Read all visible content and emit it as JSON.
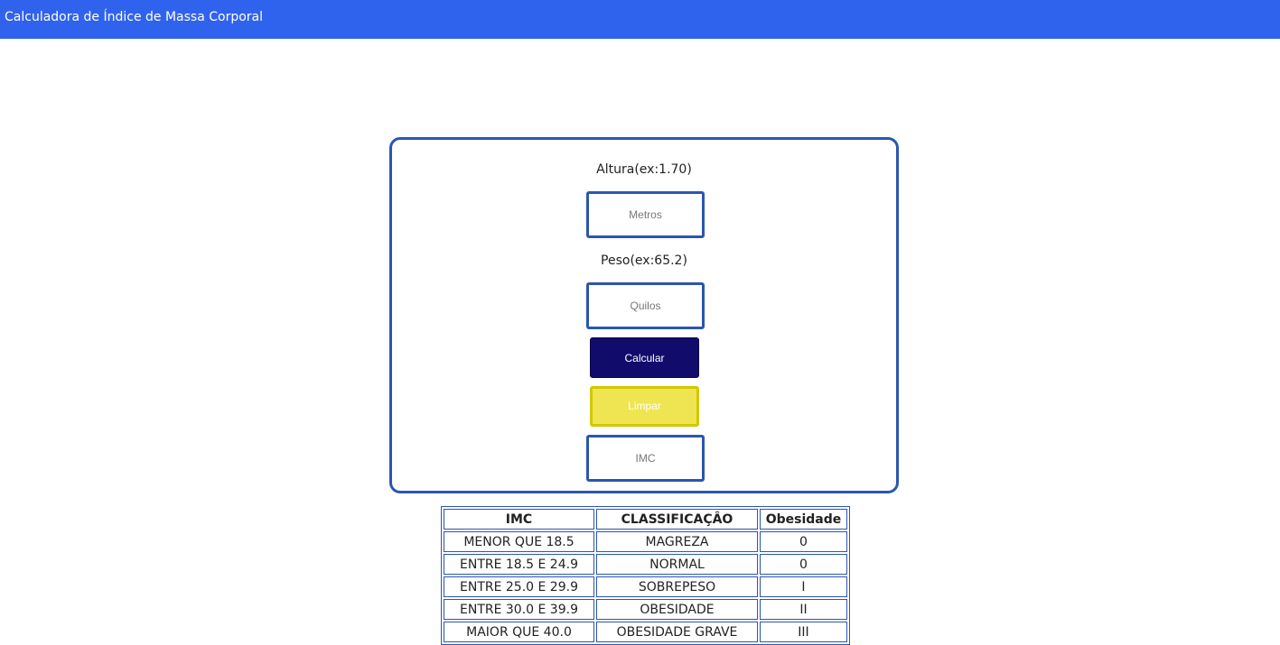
{
  "header": {
    "title": "Calculadora de Índice de Massa Corporal",
    "color": "#3063ed"
  },
  "form": {
    "height_label": "Altura(ex:1.70)",
    "height_placeholder": "Metros",
    "weight_label": "Peso(ex:65.2)",
    "weight_placeholder": "Quilos",
    "calculate_label": "Calcular",
    "clear_label": "Limpar",
    "result_placeholder": "IMC"
  },
  "table": {
    "headers": [
      "IMC",
      "CLASSIFICAÇÂO",
      "Obesidade"
    ],
    "rows": [
      [
        "MENOR QUE 18.5",
        "MAGREZA",
        "0"
      ],
      [
        "ENTRE 18.5 E 24.9",
        "NORMAL",
        "0"
      ],
      [
        "ENTRE 25.0 E 29.9",
        "SOBREPESO",
        "I"
      ],
      [
        "ENTRE 30.0 E 39.9",
        "OBESIDADE",
        "II"
      ],
      [
        "MAIOR QUE 40.0",
        "OBESIDADE GRAVE",
        "III"
      ]
    ]
  }
}
